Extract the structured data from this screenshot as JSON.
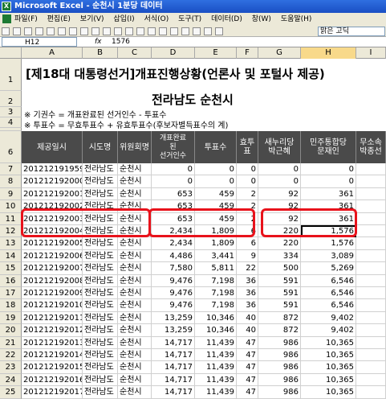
{
  "window": {
    "title": "Microsoft Excel - 순천시 1분당 데이터"
  },
  "menu": [
    "파일(F)",
    "편집(E)",
    "보기(V)",
    "삽입(I)",
    "서식(O)",
    "도구(T)",
    "데이터(D)",
    "창(W)",
    "도움말(H)"
  ],
  "toolbar": {
    "font": "맑은 고딕"
  },
  "formula": {
    "cell": "H12",
    "fx": "fx",
    "value": "1576"
  },
  "columns": [
    "A",
    "B",
    "C",
    "D",
    "E",
    "F",
    "G",
    "H",
    "I"
  ],
  "title": "[제18대 대통령선거]개표진행상황(언론사 및 포털사 제공)",
  "subtitle": "전라남도 순천시",
  "note1": "※ 기권수 = 개표완료된 선거인수 - 투표수",
  "note2": "※ 투표수 = 무효투표수 + 유효투표수(후보자별득표수의 계)",
  "headers": [
    "제공일시",
    "시도명",
    "위원회명",
    "개표완료\n된\n선거인수",
    "투표수",
    "효투표",
    "새누리당\n박근혜",
    "민주통합당\n문재인",
    "무소속\n박종선"
  ],
  "rows": [
    [
      "201212191959",
      "전라남도",
      "순천시",
      "0",
      "0",
      "0",
      "0",
      "0",
      ""
    ],
    [
      "201212192000",
      "전라남도",
      "순천시",
      "0",
      "0",
      "0",
      "0",
      "0",
      ""
    ],
    [
      "201212192001",
      "전라남도",
      "순천시",
      "653",
      "459",
      "2",
      "92",
      "361",
      ""
    ],
    [
      "201212192002",
      "전라남도",
      "순천시",
      "653",
      "459",
      "2",
      "92",
      "361",
      ""
    ],
    [
      "201212192003",
      "전라남도",
      "순천시",
      "653",
      "459",
      "2",
      "92",
      "361",
      ""
    ],
    [
      "201212192004",
      "전라남도",
      "순천시",
      "2,434",
      "1,809",
      "6",
      "220",
      "1,576",
      ""
    ],
    [
      "201212192005",
      "전라남도",
      "순천시",
      "2,434",
      "1,809",
      "6",
      "220",
      "1,576",
      ""
    ],
    [
      "201212192006",
      "전라남도",
      "순천시",
      "4,486",
      "3,441",
      "9",
      "334",
      "3,089",
      ""
    ],
    [
      "201212192007",
      "전라남도",
      "순천시",
      "7,580",
      "5,811",
      "22",
      "500",
      "5,269",
      ""
    ],
    [
      "201212192008",
      "전라남도",
      "순천시",
      "9,476",
      "7,198",
      "36",
      "591",
      "6,546",
      ""
    ],
    [
      "201212192009",
      "전라남도",
      "순천시",
      "9,476",
      "7,198",
      "36",
      "591",
      "6,546",
      ""
    ],
    [
      "201212192010",
      "전라남도",
      "순천시",
      "9,476",
      "7,198",
      "36",
      "591",
      "6,546",
      ""
    ],
    [
      "201212192011",
      "전라남도",
      "순천시",
      "13,259",
      "10,346",
      "40",
      "872",
      "9,402",
      ""
    ],
    [
      "201212192012",
      "전라남도",
      "순천시",
      "13,259",
      "10,346",
      "40",
      "872",
      "9,402",
      ""
    ],
    [
      "201212192013",
      "전라남도",
      "순천시",
      "14,717",
      "11,439",
      "47",
      "986",
      "10,365",
      ""
    ],
    [
      "201212192014",
      "전라남도",
      "순천시",
      "14,717",
      "11,439",
      "47",
      "986",
      "10,365",
      ""
    ],
    [
      "201212192015",
      "전라남도",
      "순천시",
      "14,717",
      "11,439",
      "47",
      "986",
      "10,365",
      ""
    ],
    [
      "201212192016",
      "전라남도",
      "순천시",
      "14,717",
      "11,439",
      "47",
      "986",
      "10,365",
      ""
    ],
    [
      "201212192017",
      "전라남도",
      "순천시",
      "14,717",
      "11,439",
      "47",
      "986",
      "10,365",
      ""
    ]
  ],
  "rowNumbers": [
    "1",
    "2",
    "3",
    "4",
    "5",
    "6",
    "7",
    "8",
    "9",
    "10",
    "11",
    "12",
    "13",
    "14",
    "15",
    "16",
    "17",
    "18",
    "19",
    "20",
    "21",
    "22",
    "23",
    "24",
    "25"
  ]
}
